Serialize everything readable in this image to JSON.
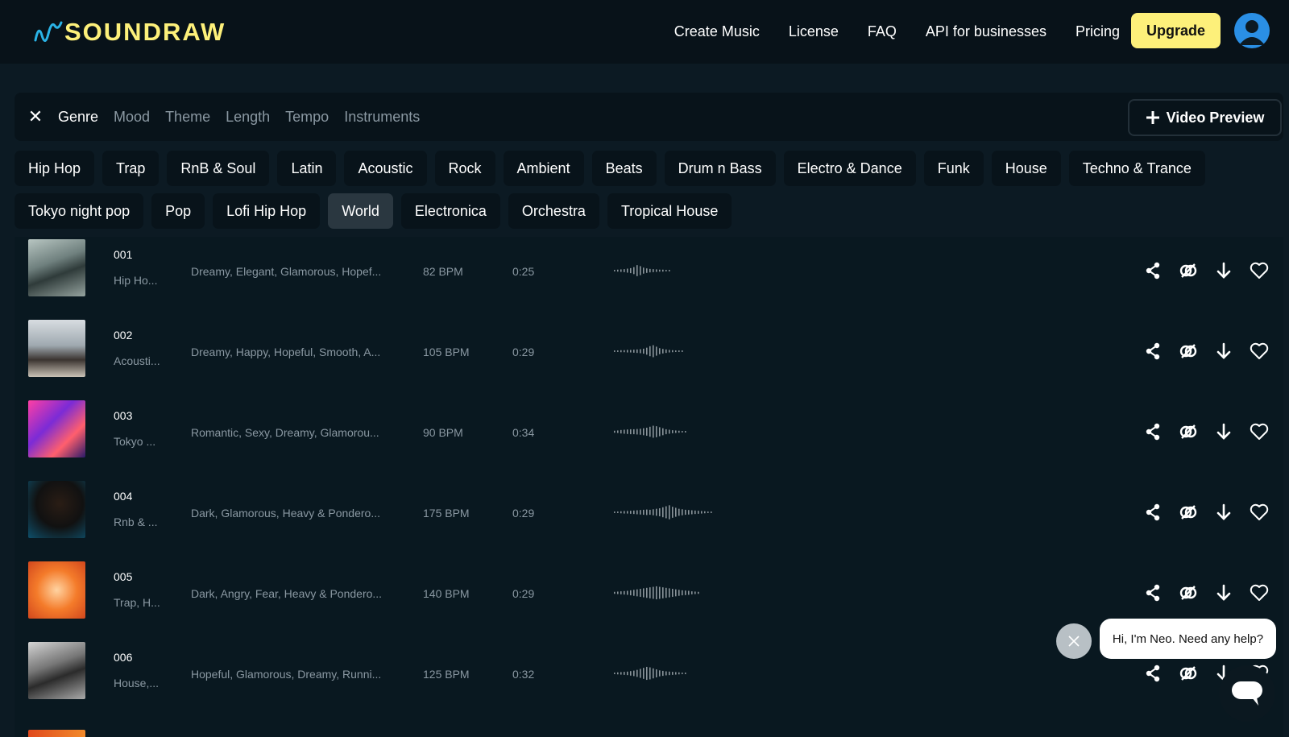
{
  "header": {
    "logo_text": "SOUNDRAW",
    "nav": [
      "Create Music",
      "License",
      "FAQ",
      "API for businesses",
      "Pricing"
    ],
    "upgrade_label": "Upgrade",
    "accent": "#fdf07a"
  },
  "filters": {
    "tabs": [
      "Genre",
      "Mood",
      "Theme",
      "Length",
      "Tempo",
      "Instruments"
    ],
    "active_tab": "Genre",
    "video_preview_label": "Video Preview",
    "genres_row1": [
      "Hip Hop",
      "Trap",
      "RnB & Soul",
      "Latin",
      "Acoustic",
      "Rock",
      "Ambient",
      "Beats",
      "Drum n Bass",
      "Electro & Dance",
      "Funk",
      "House",
      "Techno & Trance"
    ],
    "genres_row2": [
      "Tokyo night pop",
      "Pop",
      "Lofi Hip Hop",
      "World",
      "Electronica",
      "Orchestra",
      "Tropical House"
    ],
    "selected_genre": "World"
  },
  "tracks": [
    {
      "num": "001",
      "genre": "Hip Ho...",
      "moods": "Dreamy, Elegant, Glamorous, Hopef...",
      "bpm": "82 BPM",
      "duration": "0:25"
    },
    {
      "num": "002",
      "genre": "Acousti...",
      "moods": "Dreamy, Happy, Hopeful, Smooth, A...",
      "bpm": "105 BPM",
      "duration": "0:29"
    },
    {
      "num": "003",
      "genre": "Tokyo ...",
      "moods": "Romantic, Sexy, Dreamy, Glamorou...",
      "bpm": "90 BPM",
      "duration": "0:34"
    },
    {
      "num": "004",
      "genre": "Rnb & ...",
      "moods": "Dark, Glamorous, Heavy & Pondero...",
      "bpm": "175 BPM",
      "duration": "0:29"
    },
    {
      "num": "005",
      "genre": "Trap, H...",
      "moods": "Dark, Angry, Fear, Heavy & Pondero...",
      "bpm": "140 BPM",
      "duration": "0:29"
    },
    {
      "num": "006",
      "genre": "House,...",
      "moods": "Hopeful, Glamorous, Dreamy, Runni...",
      "bpm": "125 BPM",
      "duration": "0:32"
    }
  ],
  "icons": [
    "share-icon",
    "unlink-icon",
    "download-icon",
    "heart-icon"
  ],
  "chat": {
    "message": "Hi, I'm Neo. Need any help?"
  }
}
